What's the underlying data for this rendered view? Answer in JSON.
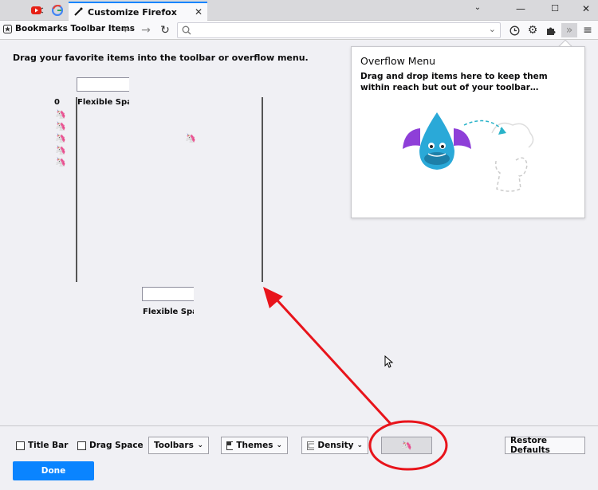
{
  "tabs": {
    "active_title": "Customize Firefox"
  },
  "toolbar": {
    "bookmarks_label": "Bookmarks Toolbar Items"
  },
  "main": {
    "instructions": "Drag your favorite items into the toolbar or overflow menu.",
    "flex_space_top": "Flexible Space",
    "flex_space_bottom": "Flexible Space",
    "counter": "0"
  },
  "overflow": {
    "title": "Overflow Menu",
    "description": "Drag and drop items here to keep them within reach but out of your toolbar…"
  },
  "footer": {
    "title_bar": "Title Bar",
    "drag_space": "Drag Space",
    "toolbars": "Toolbars",
    "themes": "Themes",
    "density": "Density",
    "restore": "Restore Defaults",
    "done": "Done"
  },
  "colors": {
    "accent": "#0a84ff",
    "annotation": "#e8141b"
  }
}
